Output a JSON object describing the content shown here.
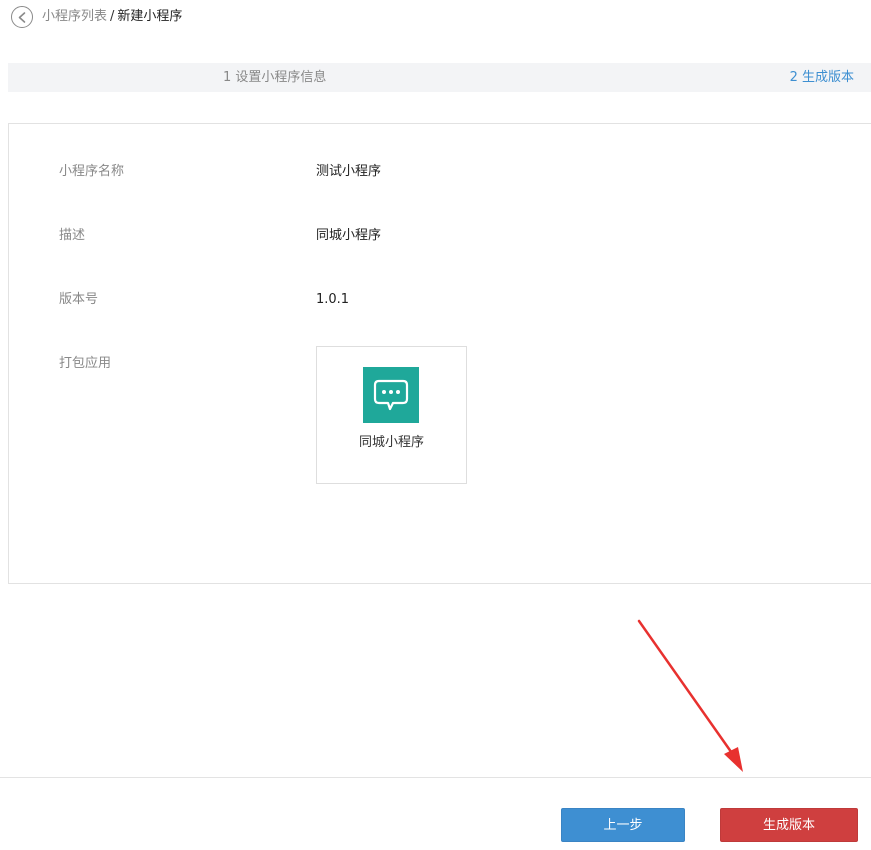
{
  "header": {
    "breadcrumb": {
      "parent": "小程序列表",
      "separator": "/",
      "current": "新建小程序"
    }
  },
  "steps": [
    {
      "label": "1 设置小程序信息",
      "state": "done"
    },
    {
      "label": "2 生成版本",
      "state": "active"
    }
  ],
  "form": {
    "name_label": "小程序名称",
    "name_value": "测试小程序",
    "desc_label": "描述",
    "desc_value": "同城小程序",
    "version_label": "版本号",
    "version_value": "1.0.1",
    "package_label": "打包应用",
    "package_app": {
      "name": "同城小程序",
      "icon": "chat-bubble-icon",
      "icon_color": "#1fa89a"
    }
  },
  "footer": {
    "prev_label": "上一步",
    "generate_label": "生成版本"
  },
  "colors": {
    "accent_blue": "#3e8fd2",
    "danger_red": "#cf3f3f",
    "annotation_arrow": "#e8312f"
  }
}
